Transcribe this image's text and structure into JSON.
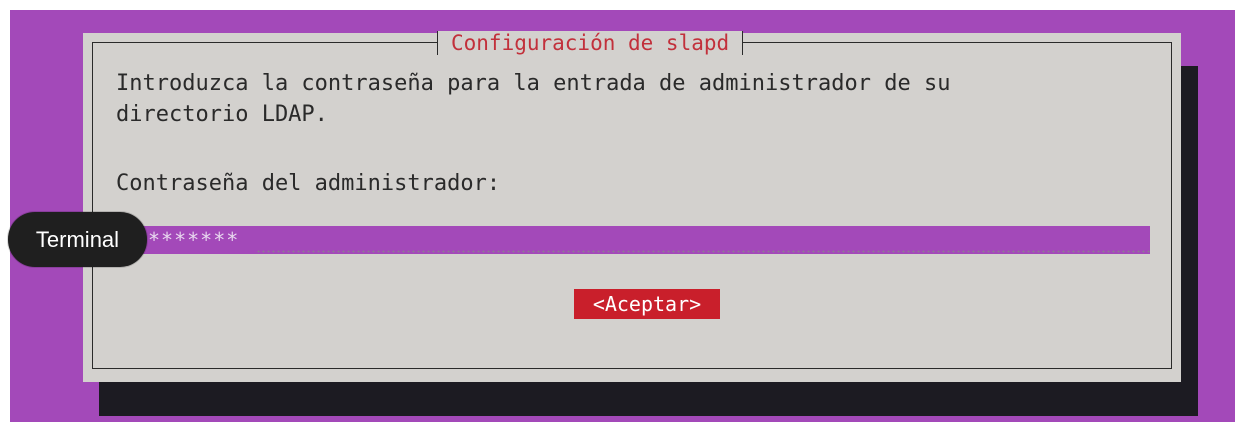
{
  "dialog": {
    "title": "Configuración de slapd",
    "message_line_1": "Introduzca la contraseña para la entrada de administrador de su",
    "message_line_2": "directorio LDAP.",
    "field_label": "Contraseña del administrador:",
    "password_masked": "*******",
    "accept_button": "<Aceptar>"
  },
  "tooltip": {
    "label": "Terminal"
  },
  "colors": {
    "background": "#a349b9",
    "dialog": "#d3d1ce",
    "shadow": "#1c1b22",
    "title_text": "#c2303b",
    "button": "#c91f2b"
  }
}
